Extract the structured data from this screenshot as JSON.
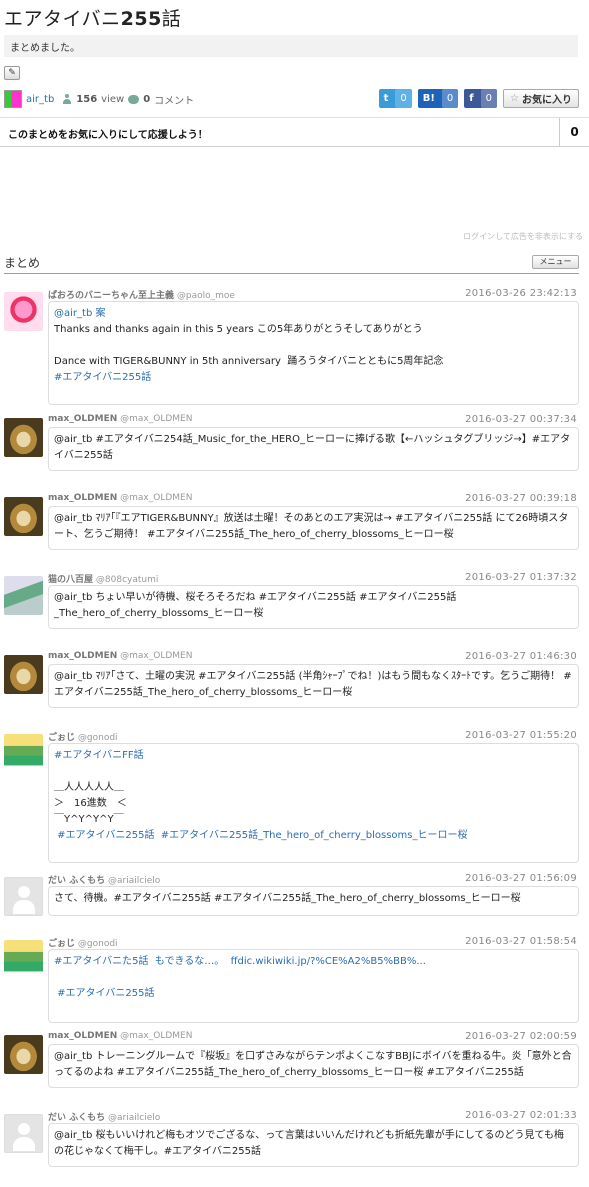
{
  "page": {
    "title_prefix": "エアタイバニ",
    "title_number": "255",
    "title_suffix": "話",
    "description": "まとめました。",
    "edit_icon": "pencil-icon",
    "author": "air_tb",
    "views_num": "156",
    "views_label": "view",
    "comments_num": "0",
    "comments_label": "コメント"
  },
  "share": {
    "twitter_icon": "t",
    "twitter_count": "0",
    "hatena_icon": "B!",
    "hatena_count": "0",
    "facebook_icon": "f",
    "facebook_count": "0",
    "favorite_label": "お気に入り",
    "favorite_icon": "☆"
  },
  "fav_bar": {
    "message": "このまとめをお気に入りにして応援しよう！",
    "count": "0"
  },
  "ad_note": "ログインして広告を非表示にする",
  "section": {
    "label": "まとめ",
    "menu_label": "メニュー"
  },
  "colors": {
    "link": "#2a6db0",
    "twitter": "#3a9bd9",
    "hatena": "#1d63b8",
    "facebook": "#3b5998"
  },
  "tweets": [
    {
      "name": "ぱおろのバニーちゃん至上主義",
      "screen": "@paolo_moe",
      "time": "2016-03-26 23:42:13",
      "lines": [
        "@air_tb 案",
        "Thanks and thanks again in this 5 years この5年ありがとうそしてありがとう",
        "",
        "Dance with TIGER&BUNNY in 5th anniversary  踊ろうタイバニとともに5周年記念",
        "#エアタイバニ255話"
      ]
    },
    {
      "name": "max_OLDMEN",
      "screen": "@max_OLDMEN",
      "time": "2016-03-27 00:37:34",
      "text": "@air_tb #エアタイバニ254話_Music_for_the_HERO_ヒーローに捧げる歌【←ハッシュタグブリッジ→】#エアタイバニ255話"
    },
    {
      "name": "max_OLDMEN",
      "screen": "@max_OLDMEN",
      "time": "2016-03-27 00:39:18",
      "text": "@air_tb ﾏﾘｱ｢『エアTIGER&BUNNY』放送は土曜！そのあとのエア実況は→ #エアタイバニ255話 にて26時頃スタート、乞うご期待！ #エアタイバニ255話_The_hero_of_cherry_blossoms_ヒーロー桜"
    },
    {
      "name": "猫の八百屋",
      "screen": "@808cyatumi",
      "time": "2016-03-27 01:37:32",
      "text": "@air_tb ちょい早いが待機、桜そろそろだね  #エアタイバニ255話  #エアタイバニ255話_The_hero_of_cherry_blossoms_ヒーロー桜"
    },
    {
      "name": "max_OLDMEN",
      "screen": "@max_OLDMEN",
      "time": "2016-03-27 01:46:30",
      "text": "@air_tb ﾏﾘｱ｢さて、土曜の実況 #エアタイバニ255話 (半角ｼｬｰﾌﾟでね！)はもう間もなくｽﾀｰﾄです。乞うご期待！ #エアタイバニ255話_The_hero_of_cherry_blossoms_ヒーロー桜"
    },
    {
      "name": "ごぉじ",
      "screen": "@gonodi",
      "time": "2016-03-27 01:55:20",
      "lines": [
        "#エアタイバニFF話",
        "",
        "＿人人人人人＿",
        "＞　16進数　＜",
        "￣Y^Y^Y^Y￣",
        " #エアタイバニ255話  #エアタイバニ255話_The_hero_of_cherry_blossoms_ヒーロー桜"
      ]
    },
    {
      "name": "だい ふくもち",
      "screen": "@ariailcielo",
      "time": "2016-03-27 01:56:09",
      "text": "さて、待機。#エアタイバニ255話 #エアタイバニ255話_The_hero_of_cherry_blossoms_ヒーロー桜"
    },
    {
      "name": "ごぉじ",
      "screen": "@gonodi",
      "time": "2016-03-27 01:58:54",
      "lines": [
        "#エアタイバニた5話  もできるな…。  ffdic.wikiwiki.jp/?%CE%A2%B5%BB%...",
        "",
        " #エアタイバニ255話"
      ]
    },
    {
      "name": "max_OLDMEN",
      "screen": "@max_OLDMEN",
      "time": "2016-03-27 02:00:59",
      "text": "@air_tb トレーニングルームで『桜坂』を口ずさみながらテンポよくこなすBBJにボイバを重ねる牛。炎「意外と合ってるのよね #エアタイバニ255話_The_hero_of_cherry_blossoms_ヒーロー桜 #エアタイバニ255話"
    },
    {
      "name": "だい ふくもち",
      "screen": "@ariailcielo",
      "time": "2016-03-27 02:01:33",
      "text": "@air_tb 桜もいいけれど梅もオツでござるな、って言葉はいいんだけれども折紙先輩が手にしてるのどう見ても梅の花じゃなくて梅干し。#エアタイバニ255話"
    }
  ]
}
